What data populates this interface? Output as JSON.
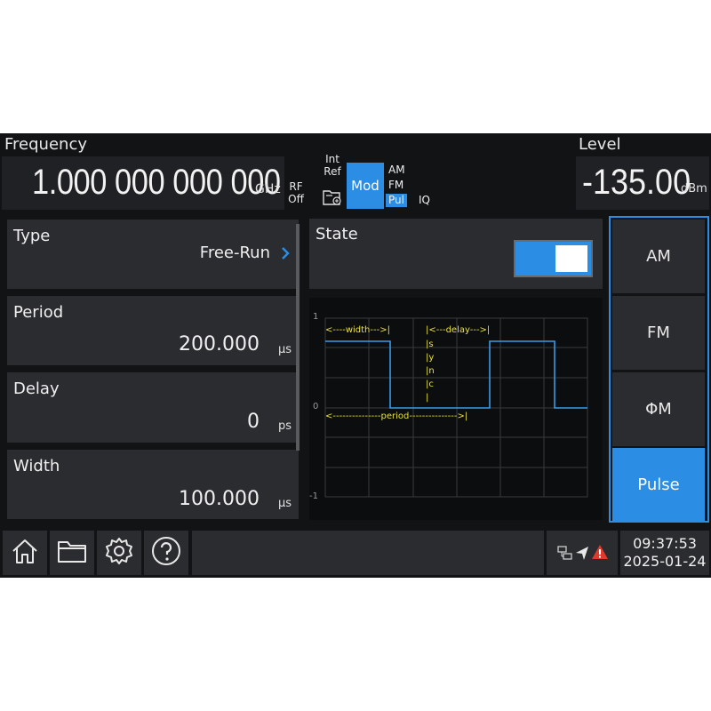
{
  "header": {
    "frequency_label": "Frequency",
    "frequency_value": "1.000 000 000 000",
    "frequency_unit": "GHz",
    "rf_line1": "RF",
    "rf_line2": "Off",
    "ref_line1": "Int",
    "ref_line2": "Ref",
    "folder_icon": "folder-settings-icon",
    "mod_label": "Mod",
    "mod_items": [
      "AM",
      "FM",
      "Pul",
      "IQ"
    ],
    "mod_selected": "Pul",
    "level_label": "Level",
    "level_value": "-135.00",
    "level_unit": "dBm"
  },
  "params": [
    {
      "title": "Type",
      "value": "Free-Run",
      "unit": ""
    },
    {
      "title": "Period",
      "value": "200.000",
      "unit": "μs"
    },
    {
      "title": "Delay",
      "value": "0",
      "unit": "ps"
    },
    {
      "title": "Width",
      "value": "100.000",
      "unit": "μs"
    }
  ],
  "state": {
    "label": "State",
    "on": true
  },
  "graph": {
    "y_ticks": [
      "1",
      "0",
      "-1"
    ],
    "width_annot": "<----width--->|",
    "delay_annot": "|<---delay--->|",
    "sync_chars": [
      "s",
      "y",
      "n",
      "c"
    ],
    "period_annot": "<---------------period--------------->|"
  },
  "right_menu": {
    "items": [
      "AM",
      "FM",
      "ΦM",
      "Pulse"
    ],
    "active": "Pulse"
  },
  "bottom": {
    "icons": [
      "home-icon",
      "folder-icon",
      "gear-icon",
      "help-icon"
    ],
    "status_icons": [
      "network-icon",
      "remote-icon",
      "warning-icon"
    ],
    "time": "09:37:53",
    "date": "2025-01-24"
  },
  "colors": {
    "accent": "#2b8de3",
    "panel": "#2b2c2f",
    "background": "#111315",
    "trace": "#3a9be8",
    "annotation": "#e8e23a",
    "warning": "#e03a2f"
  }
}
